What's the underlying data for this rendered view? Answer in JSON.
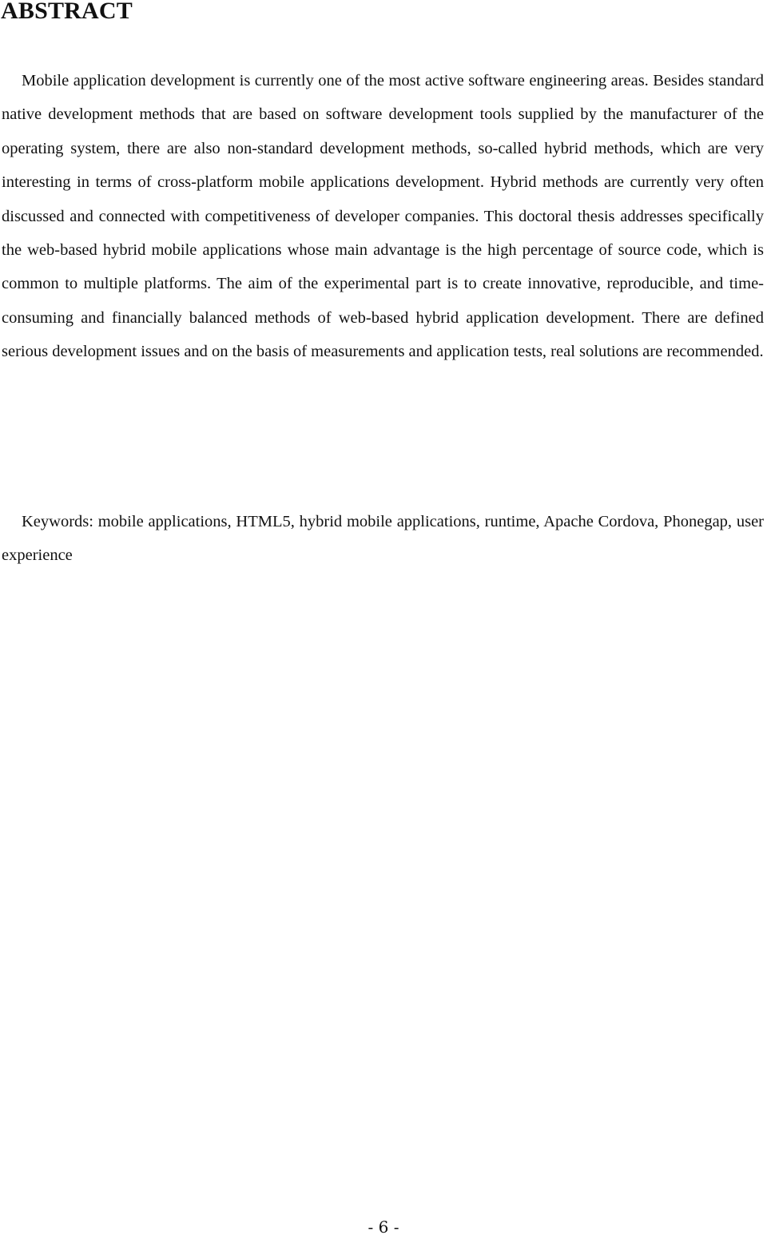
{
  "page": {
    "title": "ABSTRACT",
    "abstract": "Mobile application development is currently one of the most active software engineering areas. Besides standard native development methods that are based on software development tools supplied by the manufacturer of the operating system, there are also non-standard development methods, so-called hybrid methods, which are very interesting in terms of cross-platform mobile applications development. Hybrid methods are currently very often discussed and connected with competitiveness of developer companies. This doctoral thesis addresses specifically the web-based hybrid mobile applications whose main advantage is the high percentage of source code, which is common to multiple platforms. The aim of the experimental part is to create innovative, reproducible, and time-consuming and financially balanced methods of web-based hybrid application development. There are defined serious development issues and on the basis of measurements and application tests, real solutions are recommended.",
    "keywords": "Keywords: mobile applications, HTML5, hybrid mobile applications, runtime, Apache Cordova, Phonegap, user experience",
    "page_number": "- 6 -"
  }
}
